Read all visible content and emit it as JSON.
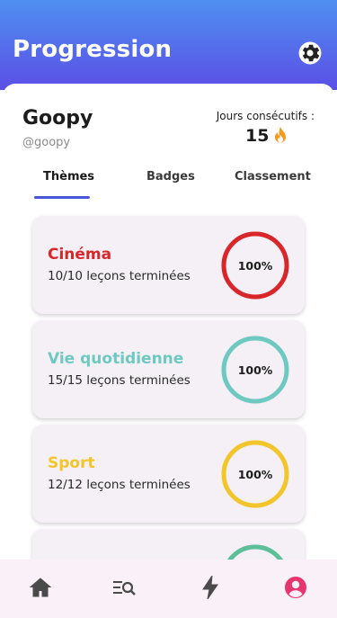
{
  "header": {
    "title": "Progression",
    "settings_icon": "gear-icon"
  },
  "profile": {
    "name": "Goopy",
    "handle": "@goopy",
    "streak_label": "Jours consécutifs :",
    "streak_value": "15",
    "streak_icon": "flame-icon"
  },
  "tabs": [
    {
      "label": "Thèmes",
      "active": true
    },
    {
      "label": "Badges",
      "active": false
    },
    {
      "label": "Classement",
      "active": false
    }
  ],
  "themes": [
    {
      "title": "Cinéma",
      "subtitle": "10/10 leçons terminées",
      "percent_label": "100%",
      "progress": 1.0,
      "color": "#d8262b"
    },
    {
      "title": "Vie quotidienne",
      "subtitle": "15/15 leçons terminées",
      "percent_label": "100%",
      "progress": 1.0,
      "color": "#6fc9c1"
    },
    {
      "title": "Sport",
      "subtitle": "12/12 leçons terminées",
      "percent_label": "100%",
      "progress": 1.0,
      "color": "#f2c52a"
    },
    {
      "title": "",
      "subtitle": "",
      "percent_label": "",
      "progress": 1.0,
      "color": "#5cbf9a"
    }
  ],
  "bottom_nav": [
    {
      "icon": "home-icon",
      "active": false
    },
    {
      "icon": "search-list-icon",
      "active": false
    },
    {
      "icon": "lightning-icon",
      "active": false
    },
    {
      "icon": "profile-icon",
      "active": true
    }
  ],
  "colors": {
    "header_top": "#4f8ff0",
    "header_bottom": "#5b4fe6",
    "accent": "#4b55d9",
    "active_nav": "#e6356f",
    "nav_inactive": "#4a4a4a"
  }
}
